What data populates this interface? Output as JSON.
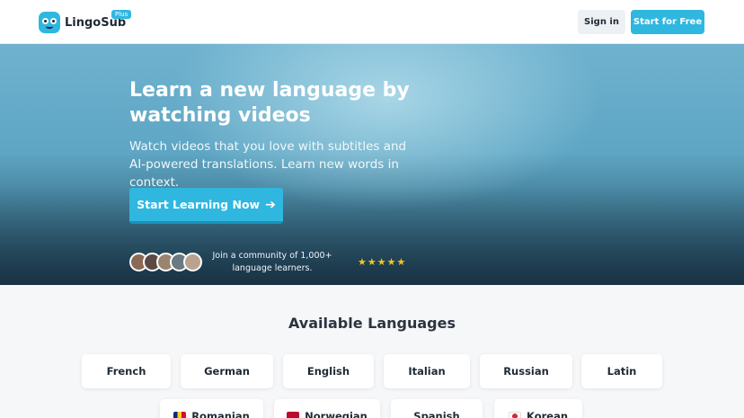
{
  "header": {
    "brand": "LingoSub",
    "plan_badge": "Plus",
    "sign_in_label": "Sign in",
    "start_free_label": "Start for Free"
  },
  "hero": {
    "title": "Learn a new language by watching videos",
    "subtitle": "Watch videos that you love with subtitles and AI-powered translations. Learn new words in context.",
    "cta_label": "Start Learning Now",
    "cta_icon": "arrow-right-icon",
    "community_text": "Join a community of 1,000+ language learners.",
    "rating_stars": "★★★★★",
    "rating_value": 5
  },
  "languages": {
    "title": "Available Languages",
    "row1": [
      "French",
      "German",
      "English",
      "Italian",
      "Russian",
      "Latin"
    ],
    "row2": [
      "Romanian",
      "Norwegian",
      "Spanish",
      "Korean"
    ]
  },
  "colors": {
    "accent": "#2fb7e0",
    "stars": "#f5c518"
  }
}
